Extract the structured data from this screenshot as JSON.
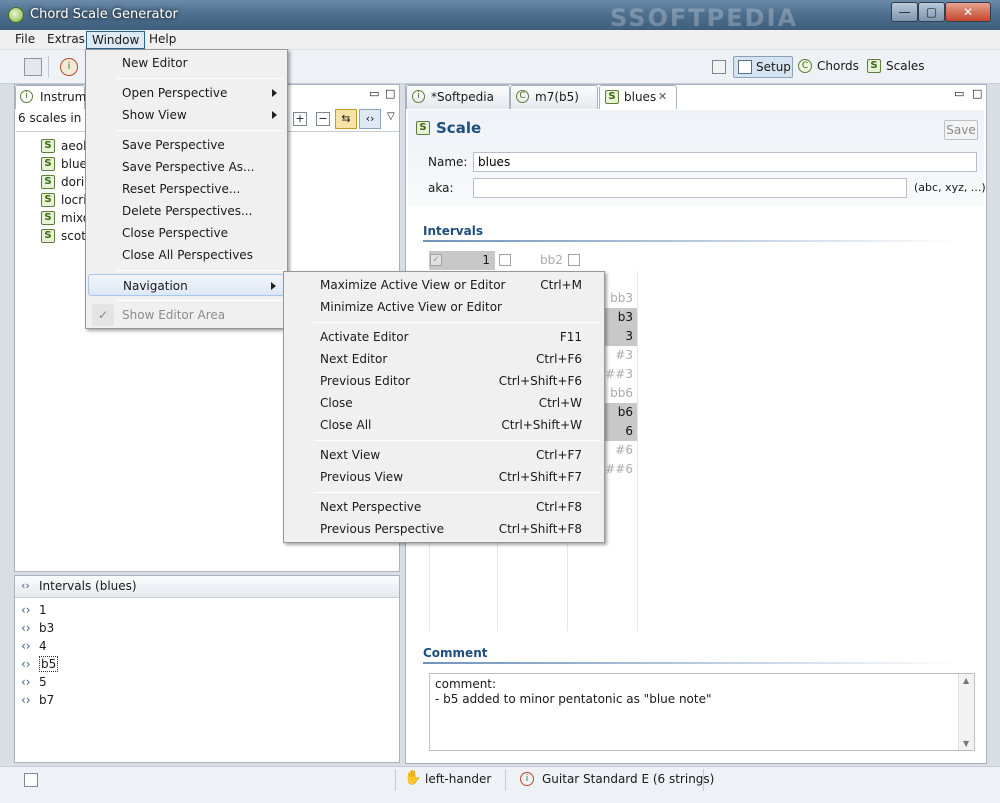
{
  "window": {
    "title": "Chord Scale Generator",
    "min": "—",
    "max": "▢",
    "close": "✕"
  },
  "menubar": [
    "File",
    "Extras",
    "Window",
    "Help"
  ],
  "perspectives": {
    "setup": "Setup",
    "chords": "Chords",
    "scales": "Scales"
  },
  "left_panel": {
    "tab": "Instrume",
    "summary": "6 scales in 0",
    "scales": [
      "aeoli",
      "blue",
      "doria",
      "locri",
      "mixo",
      "scott"
    ]
  },
  "intervals_panel": {
    "title": "Intervals (blues)",
    "items": [
      "1",
      "b3",
      "4",
      "b5",
      "5",
      "b7"
    ]
  },
  "editor_tabs": [
    "*Softpedia",
    "m7(b5)",
    "blues"
  ],
  "scale_editor": {
    "heading": "Scale",
    "save": "Save",
    "name_label": "Name:",
    "name_value": "blues",
    "aka_label": "aka:",
    "aka_value": "",
    "aka_hint": "(abc, xyz, ...)",
    "intervals_title": "Intervals",
    "interval_top": [
      "1",
      "bb2"
    ],
    "interval_col": [
      {
        "label": "bb3",
        "on": false
      },
      {
        "label": "b3",
        "on": true
      },
      {
        "label": "3",
        "on": true
      },
      {
        "label": "#3",
        "on": false
      },
      {
        "label": "##3",
        "on": false
      },
      {
        "label": "bb6",
        "on": false
      },
      {
        "label": "b6",
        "on": true
      },
      {
        "label": "6",
        "on": true
      },
      {
        "label": "#6",
        "on": false
      },
      {
        "label": "##6",
        "on": false
      }
    ],
    "comment_title": "Comment",
    "comment_line1": "comment:",
    "comment_line2": "- b5 added to minor pentatonic as \"blue note\""
  },
  "window_menu": {
    "items": [
      {
        "label": "New Editor"
      },
      {
        "label": "Open Perspective",
        "sub": true
      },
      {
        "label": "Show View",
        "sub": true
      },
      {
        "label": "Save Perspective"
      },
      {
        "label": "Save Perspective As..."
      },
      {
        "label": "Reset Perspective..."
      },
      {
        "label": "Delete Perspectives..."
      },
      {
        "label": "Close Perspective"
      },
      {
        "label": "Close All Perspectives"
      },
      {
        "label": "Navigation",
        "sub": true
      },
      {
        "label": "Show Editor Area"
      }
    ]
  },
  "navigation_menu": {
    "items": [
      {
        "label": "Maximize Active View or Editor",
        "shortcut": "Ctrl+M"
      },
      {
        "label": "Minimize Active View or Editor",
        "shortcut": ""
      },
      {
        "label": "Activate Editor",
        "shortcut": "F11"
      },
      {
        "label": "Next Editor",
        "shortcut": "Ctrl+F6"
      },
      {
        "label": "Previous Editor",
        "shortcut": "Ctrl+Shift+F6"
      },
      {
        "label": "Close",
        "shortcut": "Ctrl+W"
      },
      {
        "label": "Close All",
        "shortcut": "Ctrl+Shift+W"
      },
      {
        "label": "Next View",
        "shortcut": "Ctrl+F7"
      },
      {
        "label": "Previous View",
        "shortcut": "Ctrl+Shift+F7"
      },
      {
        "label": "Next Perspective",
        "shortcut": "Ctrl+F8"
      },
      {
        "label": "Previous Perspective",
        "shortcut": "Ctrl+Shift+F8"
      }
    ]
  },
  "status": {
    "hand": "left-hander",
    "tuning": "Guitar Standard E (6 strings)"
  },
  "watermark": "SOFTPEDIA"
}
